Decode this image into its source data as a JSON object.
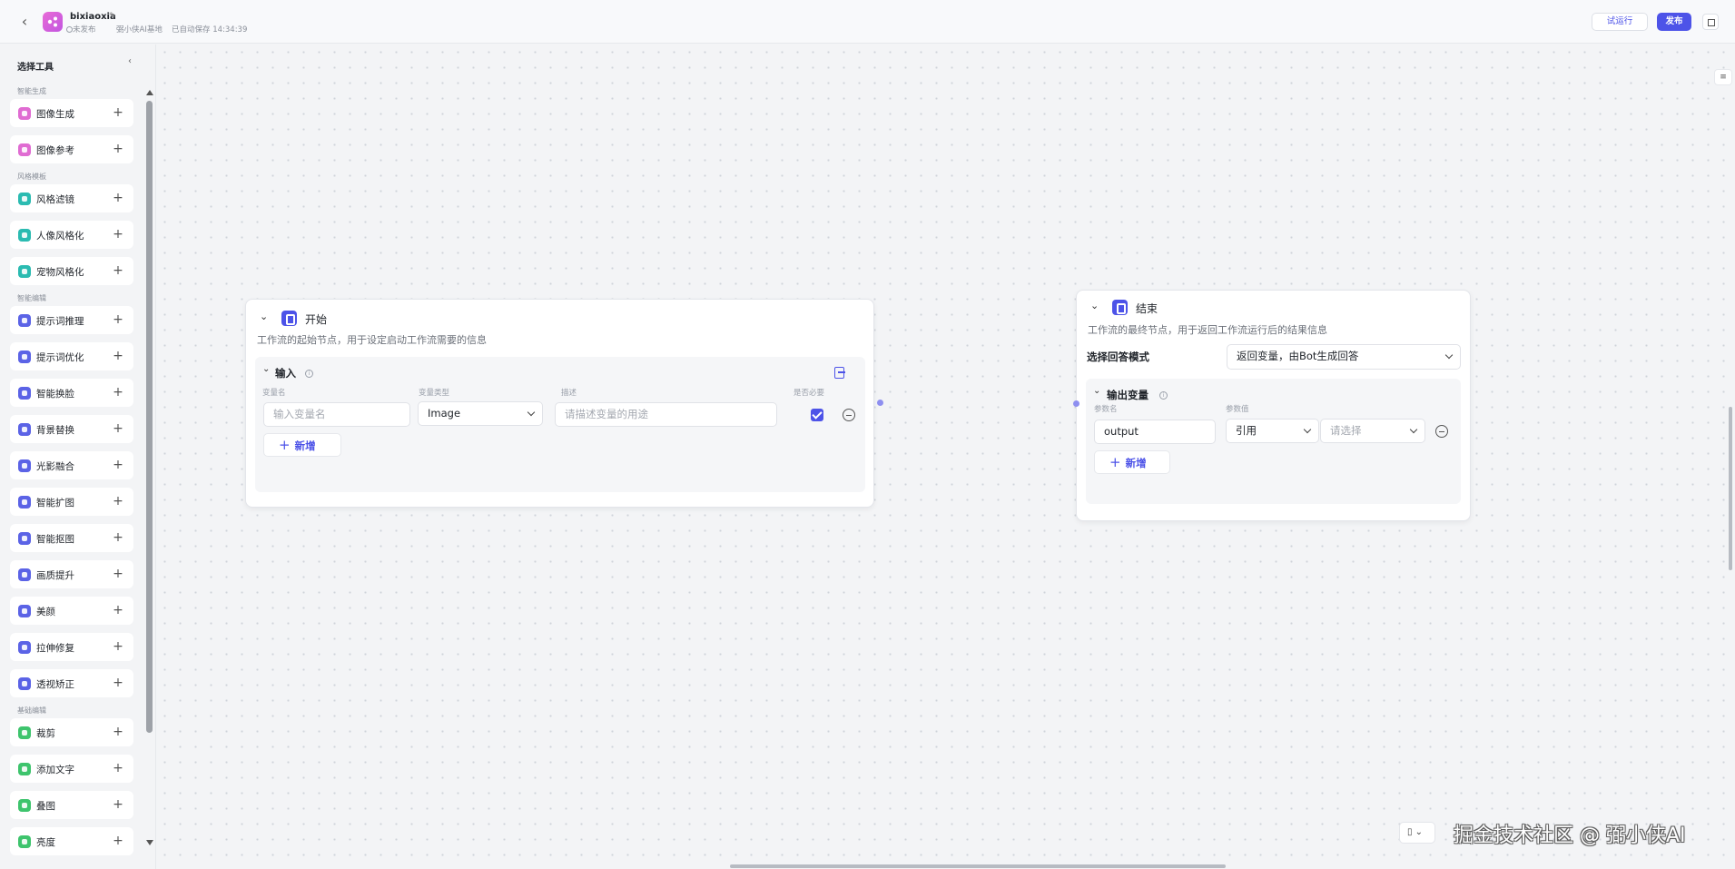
{
  "header": {
    "back_icon": "chevron-left-icon",
    "app_name": "bixiaoxia",
    "publish_status": "未发布",
    "workspace": "弼小侠AI基地",
    "autosave": "已自动保存 14:34:39",
    "test_run_label": "试运行",
    "publish_label": "发布"
  },
  "sidebar": {
    "title": "选择工具",
    "sections": [
      {
        "label": "智能生成",
        "items": [
          {
            "label": "图像生成",
            "color": "#e06cd2"
          },
          {
            "label": "图像参考",
            "color": "#e06cd2"
          }
        ]
      },
      {
        "label": "风格模板",
        "items": [
          {
            "label": "风格滤镜",
            "color": "#2bbbb1"
          },
          {
            "label": "人像风格化",
            "color": "#2bbbb1"
          },
          {
            "label": "宠物风格化",
            "color": "#2bbbb1"
          }
        ]
      },
      {
        "label": "智能编辑",
        "items": [
          {
            "label": "提示词推理",
            "color": "#5b63e6"
          },
          {
            "label": "提示词优化",
            "color": "#5b63e6"
          },
          {
            "label": "智能换脸",
            "color": "#5b63e6"
          },
          {
            "label": "背景替换",
            "color": "#5b63e6"
          },
          {
            "label": "光影融合",
            "color": "#5b63e6"
          },
          {
            "label": "智能扩图",
            "color": "#5b63e6"
          },
          {
            "label": "智能抠图",
            "color": "#5b63e6"
          },
          {
            "label": "画质提升",
            "color": "#5b63e6"
          },
          {
            "label": "美颜",
            "color": "#5b63e6"
          },
          {
            "label": "拉伸修复",
            "color": "#5b63e6"
          },
          {
            "label": "透视矫正",
            "color": "#5b63e6"
          }
        ]
      },
      {
        "label": "基础编辑",
        "items": [
          {
            "label": "裁剪",
            "color": "#3ec46d"
          },
          {
            "label": "添加文字",
            "color": "#3ec46d"
          },
          {
            "label": "叠图",
            "color": "#3ec46d"
          },
          {
            "label": "亮度",
            "color": "#3ec46d"
          }
        ]
      }
    ]
  },
  "start_node": {
    "title": "开始",
    "description": "工作流的起始节点，用于设定启动工作流需要的信息",
    "input_section": {
      "title": "输入",
      "columns": {
        "name": "变量名",
        "type": "变量类型",
        "desc": "描述",
        "required": "是否必要"
      },
      "row": {
        "name_placeholder": "输入变量名",
        "type_value": "Image",
        "desc_placeholder": "请描述变量的用途",
        "required": true
      },
      "add_label": "新增"
    }
  },
  "end_node": {
    "title": "结束",
    "description": "工作流的最终节点，用于返回工作流运行后的结果信息",
    "answer_mode_label": "选择回答模式",
    "answer_mode_value": "返回变量，由Bot生成回答",
    "output_section": {
      "title": "输出变量",
      "columns": {
        "name": "参数名",
        "value": "参数值"
      },
      "row": {
        "name_value": "output",
        "ref_value": "引用",
        "select_placeholder": "请选择"
      },
      "add_label": "新增"
    }
  },
  "watermark": "掘金技术社区 @ 弼小侠AI"
}
